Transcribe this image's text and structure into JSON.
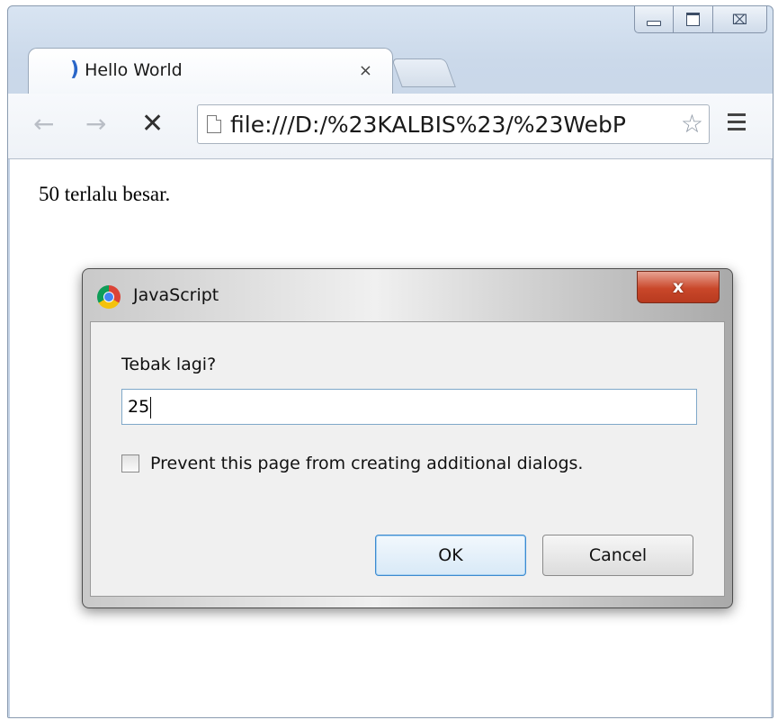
{
  "window": {
    "controls": {
      "minimize": "",
      "maximize": "",
      "close": "⌧"
    }
  },
  "tab": {
    "favicon": "loading-spinner-icon",
    "title": "Hello World",
    "close": "×"
  },
  "toolbar": {
    "back_icon": "←",
    "forward_icon": "→",
    "stop_icon": "✕",
    "url": "file:///D:/%23KALBIS%23/%23WebP",
    "star_icon": "☆"
  },
  "page": {
    "text": "50 terlalu besar."
  },
  "dialog": {
    "title": "JavaScript",
    "close_label": "x",
    "message": "Tebak lagi?",
    "input_value": "25",
    "checkbox_label": "Prevent this page from creating additional dialogs.",
    "ok_label": "OK",
    "cancel_label": "Cancel"
  },
  "colors": {
    "frame": "#c6d4e6",
    "dialog_close": "#c9472a",
    "ok_border": "#3c8ad0"
  }
}
